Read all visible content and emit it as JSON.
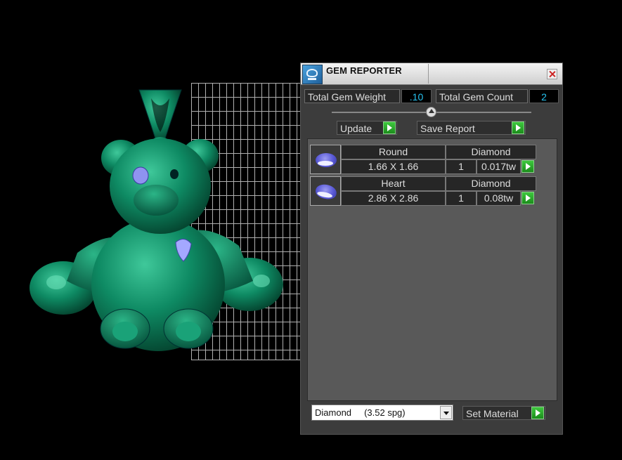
{
  "window": {
    "title": "GEM REPORTER"
  },
  "totals": {
    "weight_label": "Total Gem Weight",
    "weight_value": ".10",
    "count_label": "Total Gem Count",
    "count_value": "2"
  },
  "buttons": {
    "update": "Update",
    "save_report": "Save Report",
    "set_material": "Set Material"
  },
  "gems": [
    {
      "shape": "Round",
      "material": "Diamond",
      "size": "1.66 X 1.66",
      "qty": "1",
      "weight": "0.017tw"
    },
    {
      "shape": "Heart",
      "material": "Diamond",
      "size": "2.86 X 2.86",
      "qty": "1",
      "weight": "0.08tw"
    }
  ],
  "material": {
    "selected": "Diamond     (3.52 spg)"
  },
  "colors": {
    "model": "#0d7a5a",
    "value_text": "#27c3f0",
    "accent_button": "#2aa82a"
  }
}
